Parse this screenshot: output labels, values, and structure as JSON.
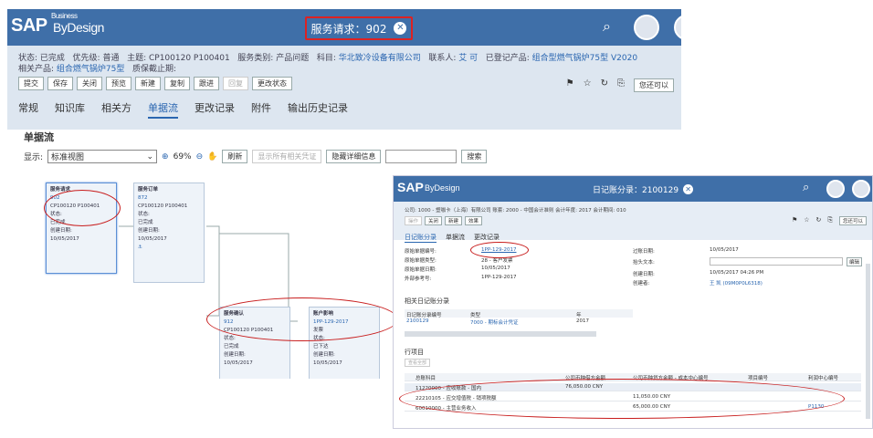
{
  "main_window": {
    "logo": {
      "brand": "SAP",
      "superscript": "Business",
      "product": "ByDesign"
    },
    "title": "服务请求：902",
    "meta_line1": [
      {
        "label": "状态:",
        "value": "已完成"
      },
      {
        "label": "优先级:",
        "value": "普通"
      },
      {
        "label": "主题:",
        "value": "CP100120 P100401"
      },
      {
        "label": "服务类别:",
        "value": "产品问题"
      },
      {
        "label": "科目:",
        "value": "华北致冷设备有限公司"
      },
      {
        "label": "联系人:",
        "value": "艾 可"
      },
      {
        "label": "已登记产品:",
        "value": "组合型燃气锅炉75型 V2020"
      }
    ],
    "meta_line2": [
      {
        "label": "相关产品:",
        "value": "组合燃气锅炉75型"
      },
      {
        "label": "质保截止期:",
        "value": ""
      }
    ],
    "buttons": [
      "提交",
      "保存",
      "关闭",
      "预览",
      "新建",
      "复制",
      "跟进",
      "回复",
      "更改状态"
    ],
    "toolbar_right_button": "您还可以",
    "tabs": [
      "常规",
      "知识库",
      "相关方",
      "单据流",
      "更改记录",
      "附件",
      "输出历史记录"
    ],
    "active_tab": "单据流",
    "section_title": "单据流",
    "display_label": "显示:",
    "view_select": "标准视图",
    "zoom": "69%",
    "btn_refresh": "刷新",
    "btn_show_all": "显示所有相关凭证",
    "btn_hide_details": "隐藏详细信息",
    "btn_search": "搜索",
    "cards": {
      "c1": {
        "title": "服务请求",
        "id": "902",
        "line1": "CP100120 P100401",
        "l2": "状态:",
        "l3": "已完成",
        "l4": "创建日期:",
        "l5": "10/05/2017"
      },
      "c2": {
        "title": "服务订单",
        "id": "872",
        "line1": "CP100120 P100401",
        "l2": "状态:",
        "l3": "已完成",
        "l4": "创建日期:",
        "l5": "10/05/2017"
      },
      "c3": {
        "title": "服务确认",
        "id": "912",
        "line1": "CP100120 P100401",
        "l2": "状态:",
        "l3": "已完成",
        "l4": "创建日期:",
        "l5": "10/05/2017"
      },
      "c4": {
        "title": "账户影响",
        "id": "1PP-129-2017",
        "line1": "发票",
        "l2": "状态:",
        "l3": "已下达",
        "l4": "创建日期:",
        "l5": "10/05/2017"
      }
    }
  },
  "journal_window": {
    "logo": {
      "brand": "SAP",
      "product": "ByDesign"
    },
    "title": "日记账分录：2100129",
    "meta": "公司: 1000 - 塑咖卡（上海）有限公司   账套: 2000 - 中国会计准则   会计年度: 2017   会计期间: 010",
    "buttons": [
      "操作",
      "关闭",
      "新建",
      "效果"
    ],
    "toolbar_right_button": "您还可以",
    "tabs": [
      "日记账分录",
      "单据流",
      "更改记录"
    ],
    "left_fields": [
      {
        "label": "原始单据编号:",
        "value": "1PP-129-2017",
        "link": true
      },
      {
        "label": "原始单据类型:",
        "value": "28 - 客户发票",
        "link": false
      },
      {
        "label": "原始单据日期:",
        "value": "10/05/2017",
        "link": false
      },
      {
        "label": "外部参考号:",
        "value": "1PP-129-2017",
        "link": false
      }
    ],
    "right_fields": [
      {
        "label": "过账日期:",
        "value": "10/05/2017",
        "link": false
      },
      {
        "label": "抬头文本:",
        "value": "",
        "link": false
      },
      {
        "label": "创建日期:",
        "value": "10/05/2017 04:26 PM",
        "link": false
      },
      {
        "label": "创建者:",
        "value": "王 凯 (09M0P0L6318)",
        "link": true
      }
    ],
    "edit_button": "编辑",
    "related_title": "相关日记账分录",
    "related_headers": [
      "日记账分录编号",
      "类型",
      "年"
    ],
    "related_row": [
      "2100129",
      "7000 - 期标会计凭证",
      "2017"
    ],
    "lines_title": "行项目",
    "lines_button": "查看全部",
    "line_headers": [
      "总账科目",
      "公司币种借方金额",
      "公司币种贷方金额 - 成本中心编号",
      "项目编号",
      "利润中心编号"
    ],
    "lines": [
      {
        "account": "11220000 - 应收账款 - 国内",
        "debit": "76,050.00 CNY",
        "credit": "",
        "profit": ""
      },
      {
        "account": "22210105 - 应交增值税 - 销项税额",
        "debit": "",
        "credit": "11,050.00 CNY",
        "profit": ""
      },
      {
        "account": "60010000 - 主营业务收入",
        "debit": "",
        "credit": "65,000.00 CNY",
        "profit": "P1130"
      }
    ]
  }
}
